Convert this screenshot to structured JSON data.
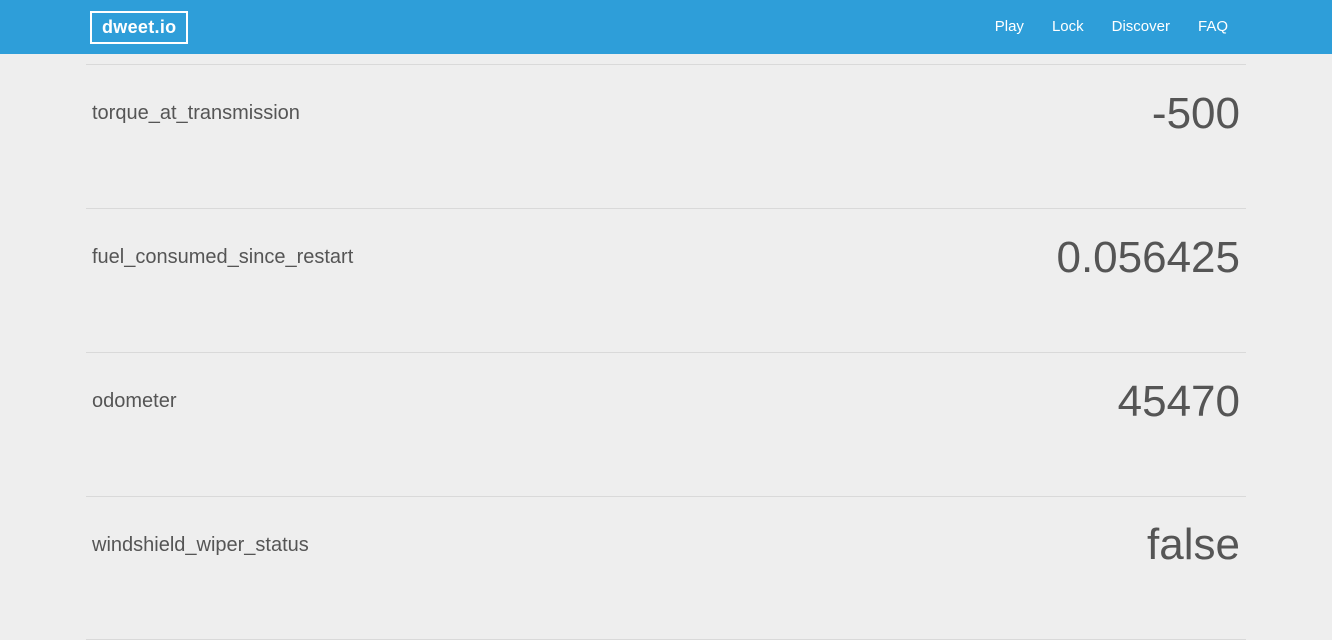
{
  "brand": "dweet.io",
  "nav": {
    "play": "Play",
    "lock": "Lock",
    "discover": "Discover",
    "faq": "FAQ"
  },
  "metrics": [
    {
      "label": "torque_at_transmission",
      "value": "-500"
    },
    {
      "label": "fuel_consumed_since_restart",
      "value": "0.056425"
    },
    {
      "label": "odometer",
      "value": "45470"
    },
    {
      "label": "windshield_wiper_status",
      "value": "false"
    }
  ]
}
